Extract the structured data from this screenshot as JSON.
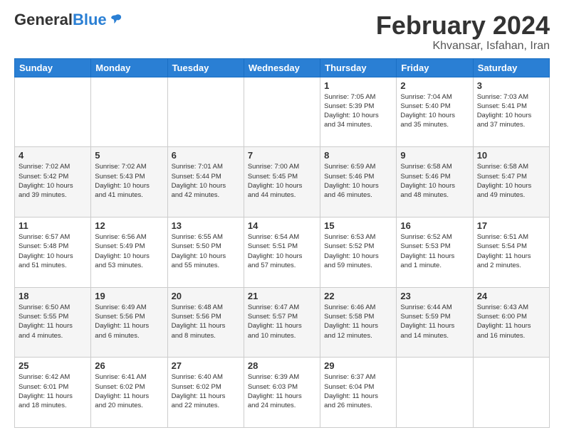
{
  "header": {
    "logo_general": "General",
    "logo_blue": "Blue",
    "month_title": "February 2024",
    "location": "Khvansar, Isfahan, Iran"
  },
  "weekdays": [
    "Sunday",
    "Monday",
    "Tuesday",
    "Wednesday",
    "Thursday",
    "Friday",
    "Saturday"
  ],
  "weeks": [
    [
      {
        "day": "",
        "info": ""
      },
      {
        "day": "",
        "info": ""
      },
      {
        "day": "",
        "info": ""
      },
      {
        "day": "",
        "info": ""
      },
      {
        "day": "1",
        "info": "Sunrise: 7:05 AM\nSunset: 5:39 PM\nDaylight: 10 hours\nand 34 minutes."
      },
      {
        "day": "2",
        "info": "Sunrise: 7:04 AM\nSunset: 5:40 PM\nDaylight: 10 hours\nand 35 minutes."
      },
      {
        "day": "3",
        "info": "Sunrise: 7:03 AM\nSunset: 5:41 PM\nDaylight: 10 hours\nand 37 minutes."
      }
    ],
    [
      {
        "day": "4",
        "info": "Sunrise: 7:02 AM\nSunset: 5:42 PM\nDaylight: 10 hours\nand 39 minutes."
      },
      {
        "day": "5",
        "info": "Sunrise: 7:02 AM\nSunset: 5:43 PM\nDaylight: 10 hours\nand 41 minutes."
      },
      {
        "day": "6",
        "info": "Sunrise: 7:01 AM\nSunset: 5:44 PM\nDaylight: 10 hours\nand 42 minutes."
      },
      {
        "day": "7",
        "info": "Sunrise: 7:00 AM\nSunset: 5:45 PM\nDaylight: 10 hours\nand 44 minutes."
      },
      {
        "day": "8",
        "info": "Sunrise: 6:59 AM\nSunset: 5:46 PM\nDaylight: 10 hours\nand 46 minutes."
      },
      {
        "day": "9",
        "info": "Sunrise: 6:58 AM\nSunset: 5:46 PM\nDaylight: 10 hours\nand 48 minutes."
      },
      {
        "day": "10",
        "info": "Sunrise: 6:58 AM\nSunset: 5:47 PM\nDaylight: 10 hours\nand 49 minutes."
      }
    ],
    [
      {
        "day": "11",
        "info": "Sunrise: 6:57 AM\nSunset: 5:48 PM\nDaylight: 10 hours\nand 51 minutes."
      },
      {
        "day": "12",
        "info": "Sunrise: 6:56 AM\nSunset: 5:49 PM\nDaylight: 10 hours\nand 53 minutes."
      },
      {
        "day": "13",
        "info": "Sunrise: 6:55 AM\nSunset: 5:50 PM\nDaylight: 10 hours\nand 55 minutes."
      },
      {
        "day": "14",
        "info": "Sunrise: 6:54 AM\nSunset: 5:51 PM\nDaylight: 10 hours\nand 57 minutes."
      },
      {
        "day": "15",
        "info": "Sunrise: 6:53 AM\nSunset: 5:52 PM\nDaylight: 10 hours\nand 59 minutes."
      },
      {
        "day": "16",
        "info": "Sunrise: 6:52 AM\nSunset: 5:53 PM\nDaylight: 11 hours\nand 1 minute."
      },
      {
        "day": "17",
        "info": "Sunrise: 6:51 AM\nSunset: 5:54 PM\nDaylight: 11 hours\nand 2 minutes."
      }
    ],
    [
      {
        "day": "18",
        "info": "Sunrise: 6:50 AM\nSunset: 5:55 PM\nDaylight: 11 hours\nand 4 minutes."
      },
      {
        "day": "19",
        "info": "Sunrise: 6:49 AM\nSunset: 5:56 PM\nDaylight: 11 hours\nand 6 minutes."
      },
      {
        "day": "20",
        "info": "Sunrise: 6:48 AM\nSunset: 5:56 PM\nDaylight: 11 hours\nand 8 minutes."
      },
      {
        "day": "21",
        "info": "Sunrise: 6:47 AM\nSunset: 5:57 PM\nDaylight: 11 hours\nand 10 minutes."
      },
      {
        "day": "22",
        "info": "Sunrise: 6:46 AM\nSunset: 5:58 PM\nDaylight: 11 hours\nand 12 minutes."
      },
      {
        "day": "23",
        "info": "Sunrise: 6:44 AM\nSunset: 5:59 PM\nDaylight: 11 hours\nand 14 minutes."
      },
      {
        "day": "24",
        "info": "Sunrise: 6:43 AM\nSunset: 6:00 PM\nDaylight: 11 hours\nand 16 minutes."
      }
    ],
    [
      {
        "day": "25",
        "info": "Sunrise: 6:42 AM\nSunset: 6:01 PM\nDaylight: 11 hours\nand 18 minutes."
      },
      {
        "day": "26",
        "info": "Sunrise: 6:41 AM\nSunset: 6:02 PM\nDaylight: 11 hours\nand 20 minutes."
      },
      {
        "day": "27",
        "info": "Sunrise: 6:40 AM\nSunset: 6:02 PM\nDaylight: 11 hours\nand 22 minutes."
      },
      {
        "day": "28",
        "info": "Sunrise: 6:39 AM\nSunset: 6:03 PM\nDaylight: 11 hours\nand 24 minutes."
      },
      {
        "day": "29",
        "info": "Sunrise: 6:37 AM\nSunset: 6:04 PM\nDaylight: 11 hours\nand 26 minutes."
      },
      {
        "day": "",
        "info": ""
      },
      {
        "day": "",
        "info": ""
      }
    ]
  ]
}
